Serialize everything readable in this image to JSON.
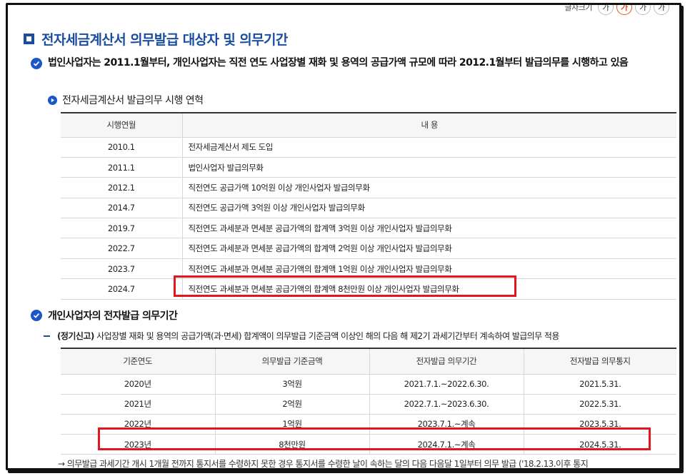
{
  "font_tools": {
    "label": "글자크기",
    "buttons": [
      "가",
      "가",
      "가",
      "가"
    ]
  },
  "title": "전자세금계산서 의무발급 대상자 및 의무기간",
  "section1": {
    "text": "법인사업자는 2011.1월부터, 개인사업자는 직전 연도 사업장별 재화 및 용역의 공급가액 규모에 따라 2012.1월부터 발급의무를 시행하고 있음",
    "subtitle": "전자세금계산서 발급의무 시행 연혁",
    "table": {
      "headers": [
        "시행연월",
        "내 용"
      ],
      "rows": [
        [
          "2010.1",
          "전자세금계산서 제도 도입"
        ],
        [
          "2011.1",
          "법인사업자 발급의무화"
        ],
        [
          "2012.1",
          "직전연도 공급가액 10억원 이상 개인사업자 발급의무화"
        ],
        [
          "2014.7",
          "직전연도 공급가액 3억원 이상 개인사업자 발급의무화"
        ],
        [
          "2019.7",
          "직전연도 과세분과 면세분 공급가액의 합계액 3억원 이상 개인사업자 발급의무화"
        ],
        [
          "2022.7",
          "직전연도 과세분과 면세분 공급가액의 합계액 2억원 이상 개인사업자 발급의무화"
        ],
        [
          "2023.7",
          "직전연도 과세분과 면세분 공급가액의 합계액 1억원 이상 개인사업자 발급의무화"
        ],
        [
          "2024.7",
          "직전연도 과세분과 면세분 공급가액의 합계액 8천만원 이상 개인사업자 발급의무화"
        ]
      ]
    }
  },
  "section2": {
    "title": "개인사업자의 전자발급 의무기간",
    "note_prefix": "(정기신고)",
    "note_text": " 사업장별 재화 및 용역의 공급가액(과·면세) 합계액이 의무발급 기준금액 이상인 해의 다음 해 제2기 과세기간부터 계속하여 발급의무 적용",
    "table": {
      "headers": [
        "기준연도",
        "의무발급 기준금액",
        "전자발급 의무기간",
        "전자발급 의무통지"
      ],
      "rows": [
        [
          "2020년",
          "3억원",
          "2021.7.1.~2022.6.30.",
          "2021.5.31."
        ],
        [
          "2021년",
          "2억원",
          "2022.7.1.~2023.6.30.",
          "2022.5.31."
        ],
        [
          "2022년",
          "1억원",
          "2023.7.1.~계속",
          "2023.5.31."
        ],
        [
          "2023년",
          "8천만원",
          "2024.7.1.~계속",
          "2024.5.31."
        ]
      ]
    },
    "footnote": "→ 의무발급 과세기간 개시 1개월 전까지 통지서를 수령하지 못한 경우 통지서를 수령한 날이 속하는 달의 다음 다음달 1일부터 의무 발급 ('18.2.13.이후 통지"
  },
  "colors": {
    "accent": "#1a4da0",
    "check": "#1a56c9",
    "highlight": "#e3161d",
    "font_accent": "#e0531b"
  }
}
